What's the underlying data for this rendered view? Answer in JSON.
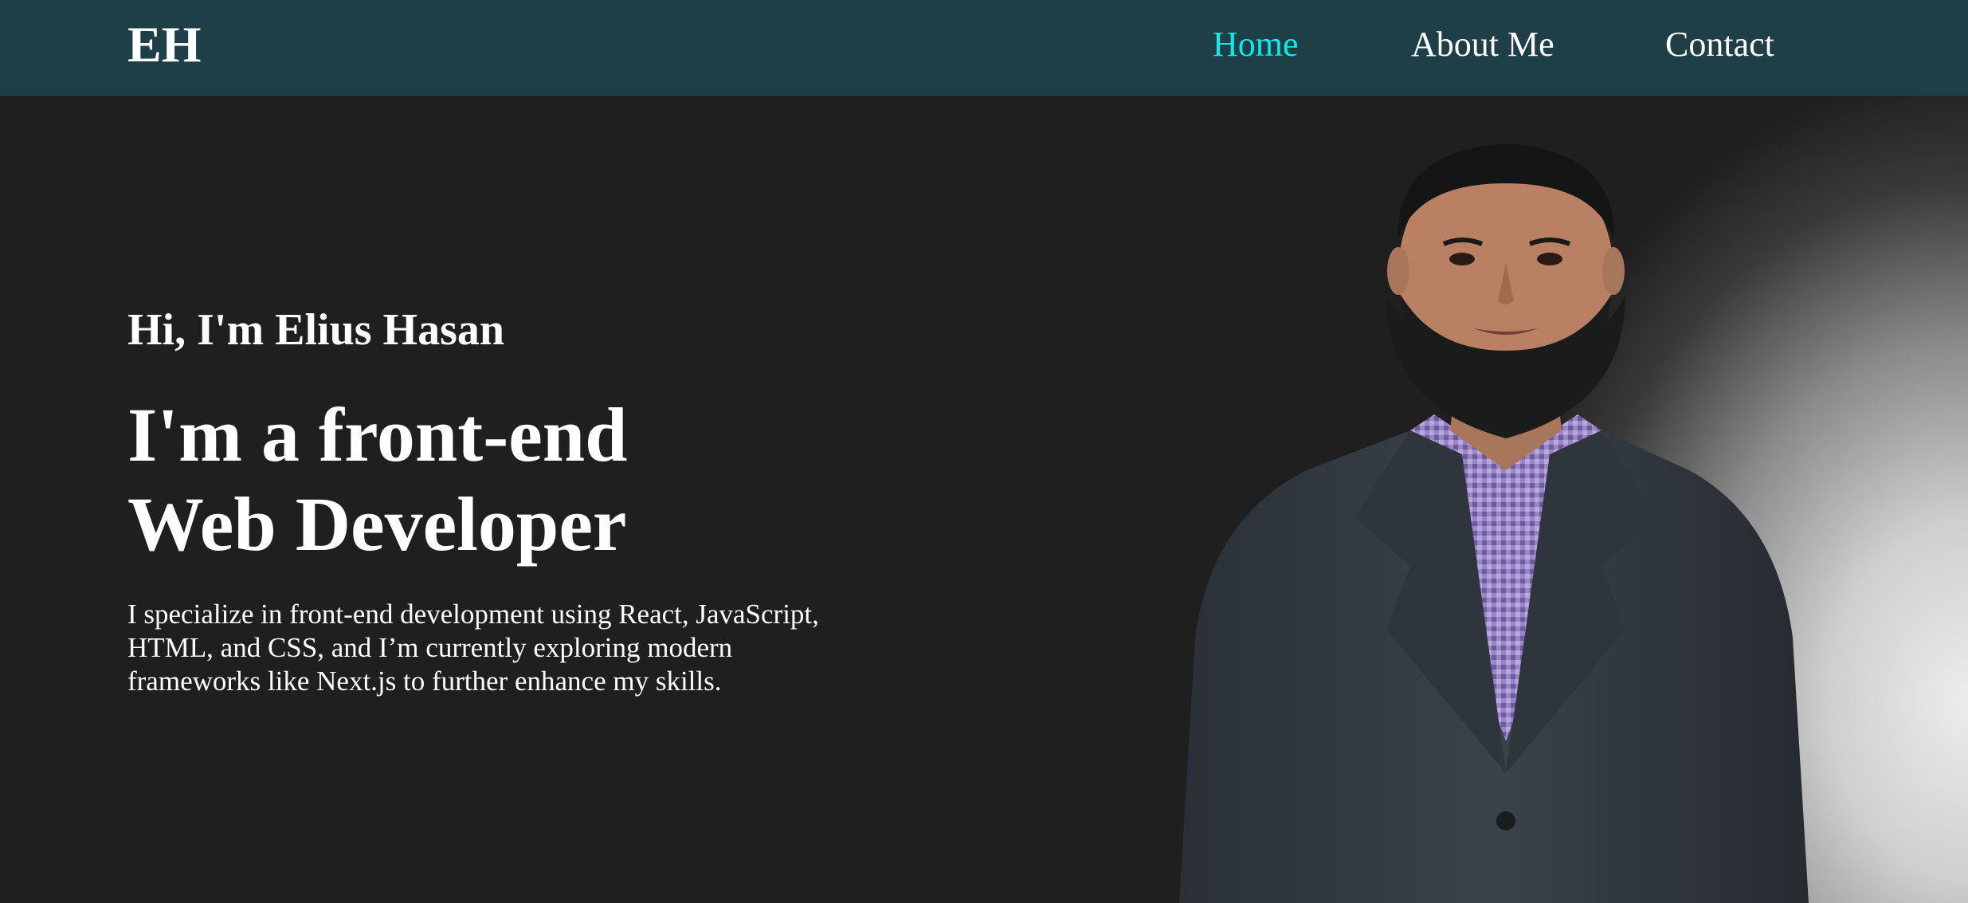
{
  "nav": {
    "logo": "EH",
    "links": [
      {
        "label": "Home",
        "active": true
      },
      {
        "label": "About Me",
        "active": false
      },
      {
        "label": "Contact",
        "active": false
      }
    ]
  },
  "hero": {
    "greeting": "Hi, I'm Elius Hasan",
    "headline_lines": [
      "I'm a front-end",
      "Web Developer"
    ],
    "bio_lines": [
      "I specialize in front-end development using React, JavaScript,",
      "HTML, and CSS, and I’m currently exploring modern",
      "frameworks like Next.js to further enhance my skills."
    ],
    "portrait_icon": "portrait-photo"
  },
  "colors": {
    "navbar_bg": "#1e3e48",
    "page_bg": "#1f1f1f",
    "active_link": "#13e8e8",
    "text": "#ffffff"
  }
}
